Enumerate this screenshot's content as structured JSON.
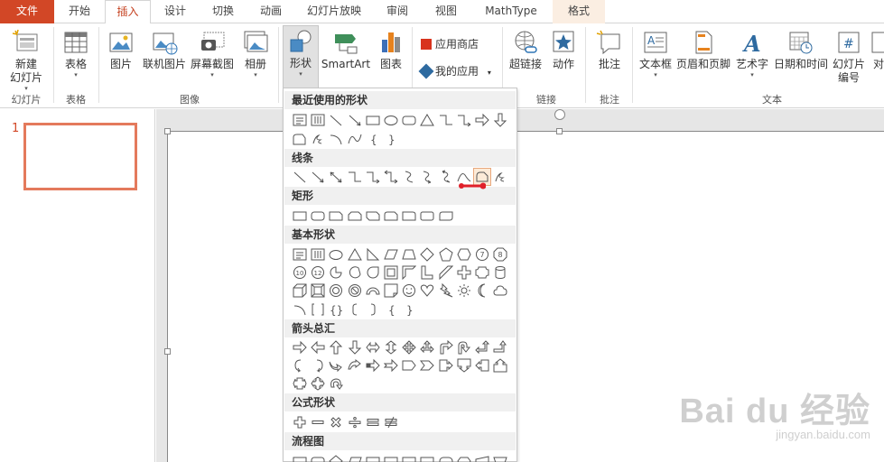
{
  "tabs": {
    "file": "文件",
    "home": "开始",
    "insert": "插入",
    "design": "设计",
    "transitions": "切换",
    "animations": "动画",
    "slideshow": "幻灯片放映",
    "review": "审阅",
    "view": "视图",
    "mathtype": "MathType",
    "format": "格式"
  },
  "ribbon": {
    "new_slide": "新建",
    "new_slide2": "幻灯片",
    "group_slides": "幻灯片",
    "table": "表格",
    "group_tables": "表格",
    "picture": "图片",
    "online_picture": "联机图片",
    "screenshot": "屏幕截图",
    "album": "相册",
    "group_images": "图像",
    "shapes": "形状",
    "smartart": "SmartArt",
    "chart": "图表",
    "app_store": "应用商店",
    "my_apps": "我的应用",
    "hyperlink": "超链接",
    "action": "动作",
    "group_links": "链接",
    "comment": "批注",
    "group_comments": "批注",
    "textbox": "文本框",
    "header_footer": "页眉和页脚",
    "wordart": "艺术字",
    "datetime": "日期和时间",
    "slide_number": "幻灯片",
    "slide_number2": "编号",
    "object": "对",
    "group_text": "文本"
  },
  "slides": {
    "number": "1"
  },
  "shapes_panel": {
    "recent": "最近使用的形状",
    "lines": "线条",
    "rectangles": "矩形",
    "basic": "基本形状",
    "arrows": "箭头总汇",
    "equation": "公式形状",
    "flowchart": "流程图"
  },
  "watermark": {
    "brand": "Bai du 经验",
    "url": "jingyan.baidu.com"
  },
  "colors": {
    "accent": "#d24726",
    "highlight": "#fdebd8",
    "annotation": "#e0202a"
  }
}
